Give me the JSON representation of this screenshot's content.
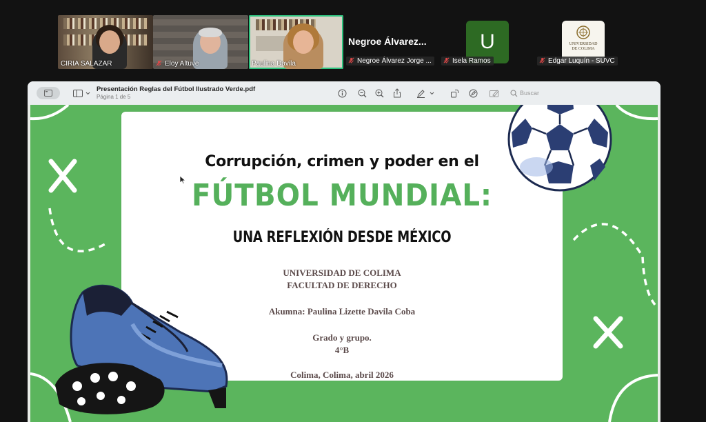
{
  "participants": [
    {
      "name": "CIRIA SALAZAR",
      "muted": false
    },
    {
      "name": "Eloy Altuve",
      "muted": true
    },
    {
      "name": "Paulina Davila",
      "muted": false
    }
  ],
  "speaker_tiles": {
    "big_name": "Negroe  Álvarez...",
    "negroe_label": "Negroe Álvarez Jorge ...",
    "isela_label": "Isela Ramos",
    "edgar_label": "Edgar Luquín - SUVC",
    "avatar_initial": "U",
    "uc_logo_line1": "UNIVERSIDAD",
    "uc_logo_line2": "DE COLIMA"
  },
  "viewer": {
    "title": "Presentación Reglas del Fútbol Ilustrado Verde.pdf",
    "page_info": "Página 1 de 5",
    "search_placeholder": "Buscar"
  },
  "slide": {
    "line1": "Corrupción, crimen y poder en el",
    "line2": "FÚTBOL MUNDIAL:",
    "line3": "UNA REFLEXIÓN DESDE MÉXICO",
    "university": "UNIVERSIDAD DE COLIMA",
    "faculty": "FACULTAD DE DERECHO",
    "student": "Akumna: Paulina Lizette Davila Coba",
    "grade_label": "Grado y grupo.",
    "grade_value": "4°B",
    "place_date": "Colima, Colima, abril 2026"
  },
  "colors": {
    "slide_green": "#5bb55d",
    "title_green": "#55b05b",
    "active_speaker": "#2ec27e",
    "avatar_green": "#2d6a23",
    "boot_blue": "#4d74b7"
  },
  "icons": [
    "mic-muted-icon",
    "sidebar-icon",
    "chevron-down-icon",
    "info-icon",
    "zoom-out-icon",
    "zoom-in-icon",
    "share-icon",
    "markup-pen-icon",
    "rotate-icon",
    "annotate-icon",
    "redact-icon",
    "search-icon"
  ]
}
